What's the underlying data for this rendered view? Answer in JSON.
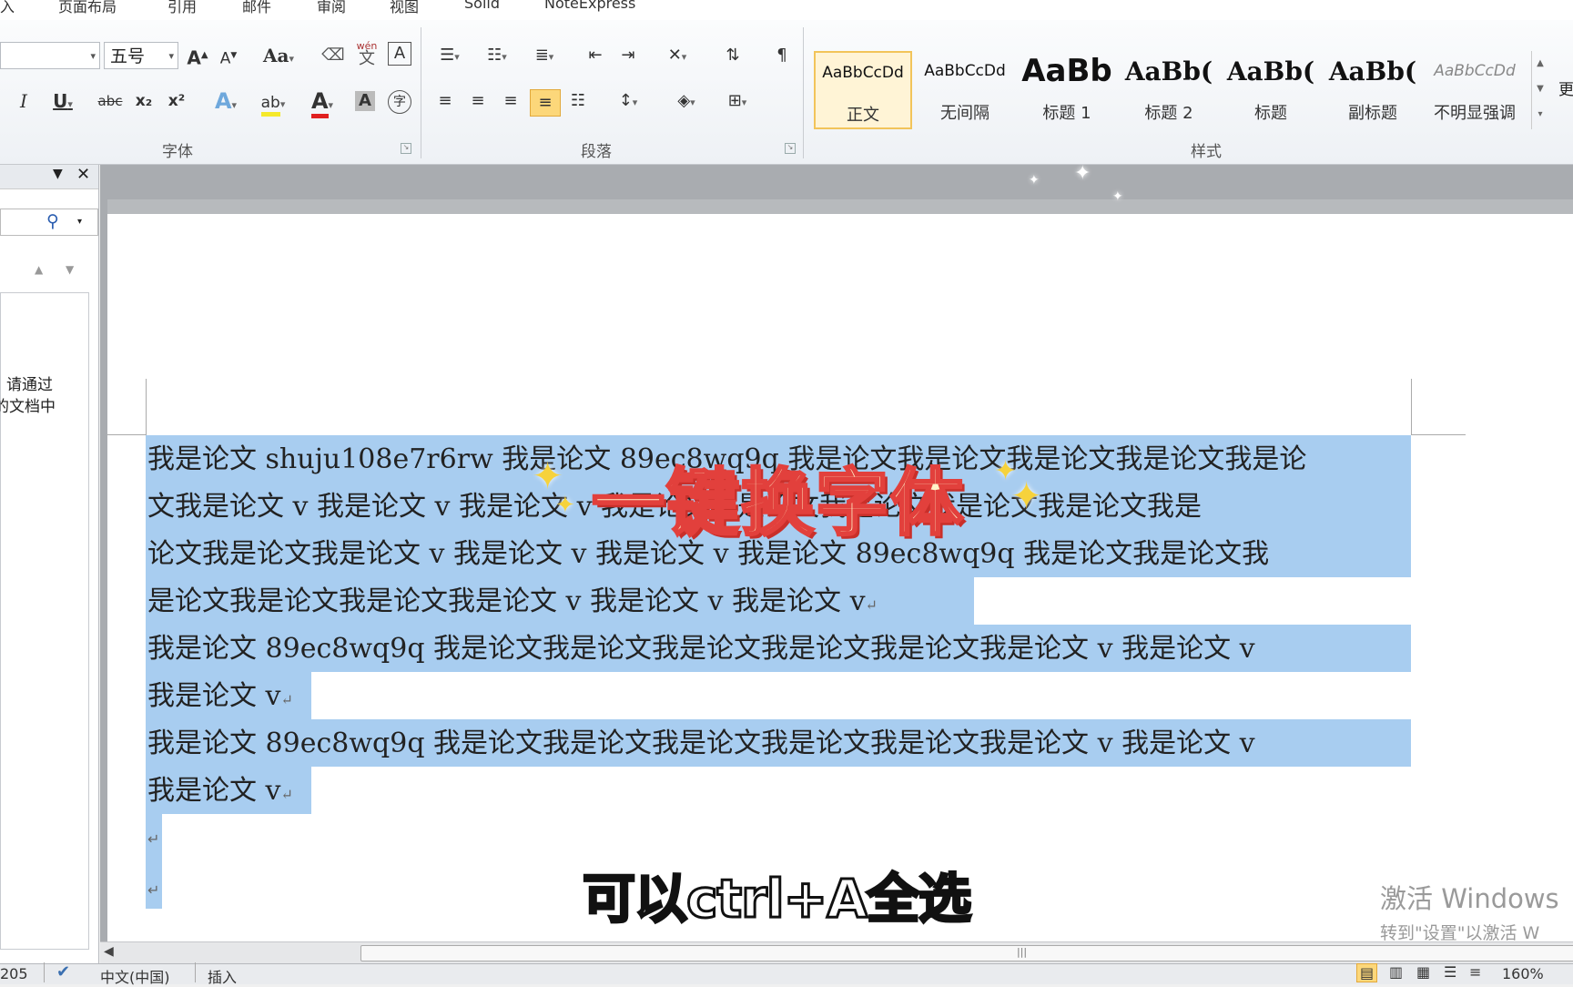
{
  "menu": {
    "tabs": [
      "入",
      "页面布局",
      "引用",
      "邮件",
      "审阅",
      "视图",
      "Solid",
      "NoteExpress"
    ]
  },
  "ribbon": {
    "font_group": {
      "label": "字体",
      "size_value": "五号",
      "grow": "A",
      "shrink": "A",
      "case": "Aa",
      "italic": "I",
      "underline": "U",
      "strike": "abc",
      "subscript": "x₂",
      "superscript": "x²",
      "highlight": "ab",
      "font_color": "A",
      "shade": "A",
      "enclose": "字",
      "phonetic": "wén"
    },
    "paragraph_group": {
      "label": "段落"
    },
    "styles_group": {
      "label": "样式",
      "more": "更",
      "items": [
        {
          "sample": "AaBbCcDd",
          "name": "正文",
          "selected": true
        },
        {
          "sample": "AaBbCcDd",
          "name": "无间隔"
        },
        {
          "sample": "AaBb",
          "name": "标题 1"
        },
        {
          "sample": "AaBb(",
          "name": "标题 2"
        },
        {
          "sample": "AaBb(",
          "name": "标题"
        },
        {
          "sample": "AaBb(",
          "name": "副标题"
        },
        {
          "sample": "AaBbCcDd",
          "name": "不明显强调"
        }
      ]
    }
  },
  "nav_pane": {
    "text_line1": "请通过",
    "text_line2": "的文档中"
  },
  "document": {
    "lines": [
      "我是论文 shuju108e7r6rw 我是论文 89ec8wq9q 我是论文我是论文我是论文我是论文我是论",
      "文我是论文 v 我是论文 v 我是论文 v 我是论文我是论文我是论文我是论文我是论文我是",
      "论文我是论文我是论文 v 我是论文 v 我是论文 v 我是论文 89ec8wq9q 我是论文我是论文我",
      "是论文我是论文我是论文我是论文 v 我是论文 v 我是论文 v",
      "我是论文 89ec8wq9q 我是论文我是论文我是论文我是论文我是论文我是论文 v 我是论文 v",
      "我是论文 v",
      "我是论文 89ec8wq9q 我是论文我是论文我是论文我是论文我是论文我是论文 v 我是论文 v",
      "我是论文 v"
    ],
    "para_mark": "↵"
  },
  "overlay": {
    "title": "一键换字体",
    "subtitle": "可以ctrl+A全选"
  },
  "watermark": {
    "line1": "激活 Windows",
    "line2": "转到\"设置\"以激活 W"
  },
  "statusbar": {
    "words": "205",
    "language": "中文(中国)",
    "mode": "插入",
    "zoom": "160%"
  },
  "colors": {
    "selection": "#a8cdf0",
    "title_fill": "#fff2c8",
    "title_stroke": "#e2403c"
  }
}
